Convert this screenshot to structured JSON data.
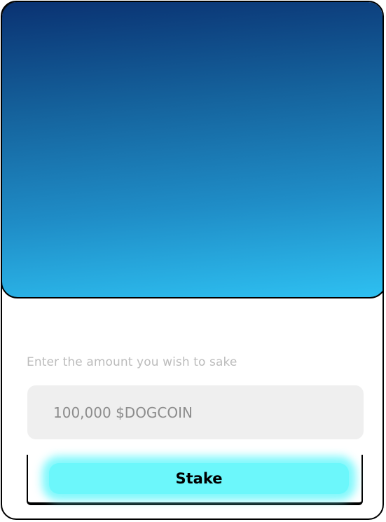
{
  "stake_form": {
    "prompt": "Enter the amount you wish to sake",
    "amount_placeholder": "100,000 $DOGCOIN",
    "stake_label": "Stake"
  }
}
